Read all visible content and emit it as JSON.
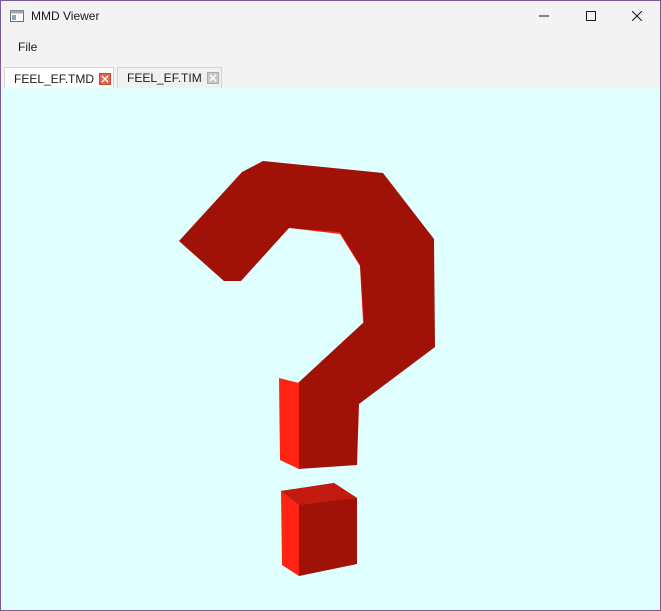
{
  "window": {
    "title": "MMD Viewer",
    "icon": "app-window-icon",
    "controls": [
      "minimize-icon",
      "maximize-icon",
      "close-icon"
    ]
  },
  "menu": {
    "items": [
      {
        "label": "File"
      }
    ]
  },
  "tabs": [
    {
      "label": "FEEL_EF.TMD",
      "active": true
    },
    {
      "label": "FEEL_EF.TIM",
      "active": false
    }
  ],
  "viewport": {
    "background": "#e0ffff",
    "model": "red 3D question mark",
    "colors": {
      "front": "#a01208",
      "side": "#ff2314",
      "dark_edge": "#c21a0e"
    }
  }
}
